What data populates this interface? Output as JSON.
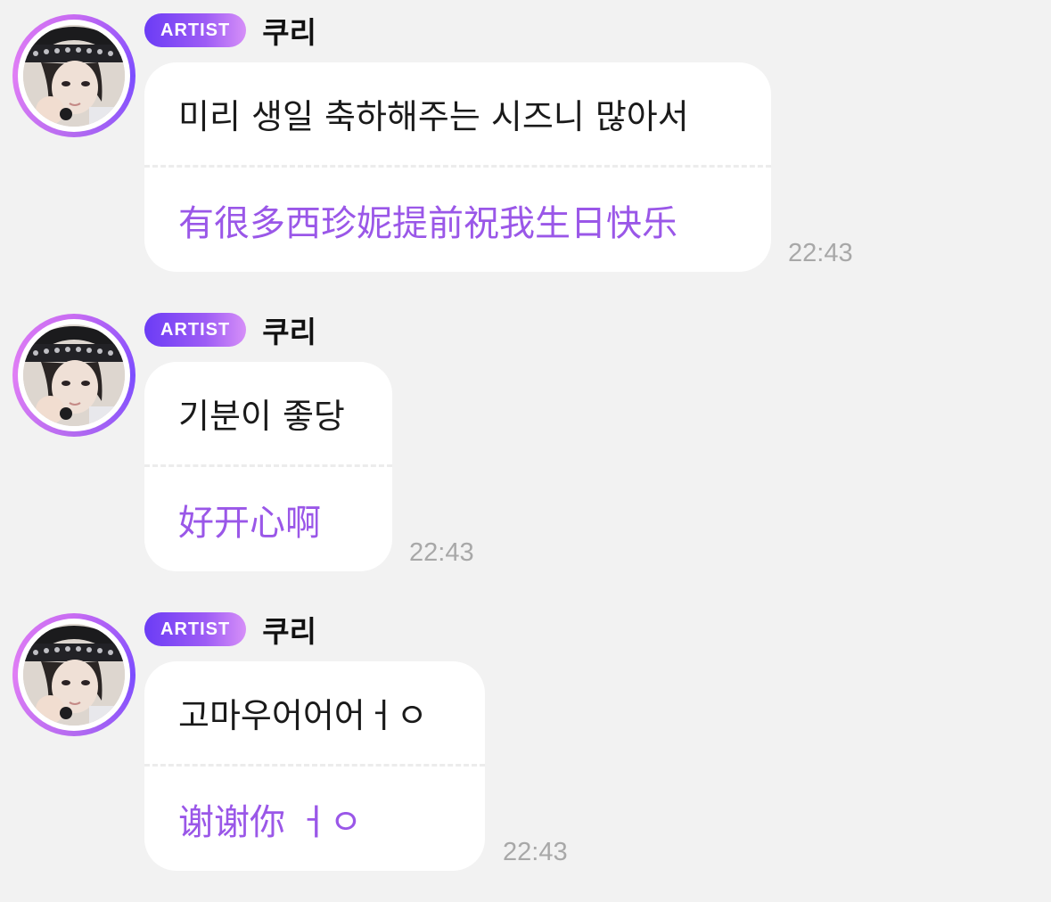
{
  "messages": [
    {
      "badge": "ARTIST",
      "sender": "쿠리",
      "original": "미리 생일 축하해주는 시즈니 많아서",
      "translation": "有很多西珍妮提前祝我生日快乐",
      "time": "22:43"
    },
    {
      "badge": "ARTIST",
      "sender": "쿠리",
      "original": "기분이 좋당",
      "translation": "好开心啊",
      "time": "22:43"
    },
    {
      "badge": "ARTIST",
      "sender": "쿠리",
      "original": "고마우어어어ㅓㅇ",
      "translation": "谢谢你 ㅓㅇ",
      "time": "22:43"
    }
  ],
  "colors": {
    "background": "#f2f2f2",
    "bubble": "#ffffff",
    "translation_text": "#9a57e8",
    "badge_gradient_start": "#6b3cf5",
    "badge_gradient_end": "#d68ff8",
    "time_text": "#a8a8a8"
  }
}
